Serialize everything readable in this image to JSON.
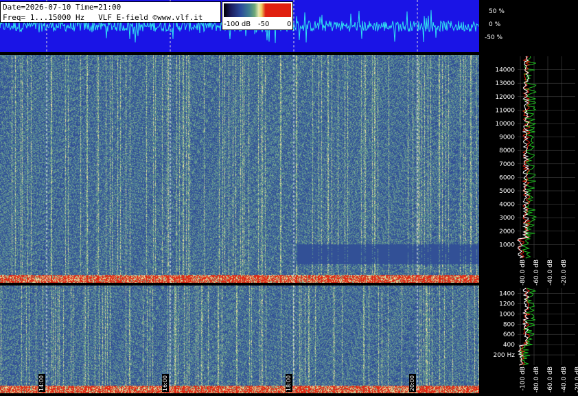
{
  "header": {
    "line1": "Date=2026-07-10 Time=21:00",
    "line2": "Freq= 1...15000 Hz   VLF E-field ©www.vlf.it"
  },
  "colorbar": {
    "labels": [
      "-100 dB",
      "-50",
      "0"
    ]
  },
  "waveform_axis": [
    "50 %",
    "0 %",
    "-50 %"
  ],
  "time_marks": [
    "14:00",
    "16:00",
    "18:00",
    "20:00"
  ],
  "chart_data": [
    {
      "type": "heatmap",
      "title": "",
      "xlabel": "",
      "ylabel": "",
      "x_ticks": [
        "14:00",
        "16:00",
        "18:00",
        "20:00"
      ],
      "y_ticks": [
        "1000",
        "2000",
        "3000",
        "4000",
        "5000",
        "6000",
        "7000",
        "8000",
        "9000",
        "10000",
        "11000",
        "12000",
        "13000",
        "14000"
      ],
      "ylim": [
        0,
        15000
      ],
      "colorbar": [
        "-100 dB",
        "-50",
        "0"
      ]
    },
    {
      "type": "heatmap",
      "x_ticks": [
        "14:00",
        "16:00",
        "18:00",
        "20:00"
      ],
      "y_ticks": [
        "200 Hz",
        "400",
        "600",
        "800",
        "1000",
        "1200",
        "1400"
      ],
      "ylim": [
        0,
        1500
      ]
    },
    {
      "type": "line",
      "x_ticks": [
        "-80.0 dB",
        "-60.0 dB",
        "-40.0 dB",
        "-20.0 dB"
      ],
      "xlim": [
        -100,
        -20
      ]
    },
    {
      "type": "line",
      "x_ticks": [
        "-100 dB",
        "-80.0 dB",
        "-60.0 dB",
        "-40.0 dB",
        "-20.0 dB"
      ],
      "xlim": [
        -100,
        -20
      ]
    }
  ],
  "colors": {
    "wave_bg": "#1a14e6",
    "wave_line": "#30e0f0",
    "trace_red": "#e02010",
    "trace_green": "#20c020",
    "trace_white": "#ffffff"
  }
}
